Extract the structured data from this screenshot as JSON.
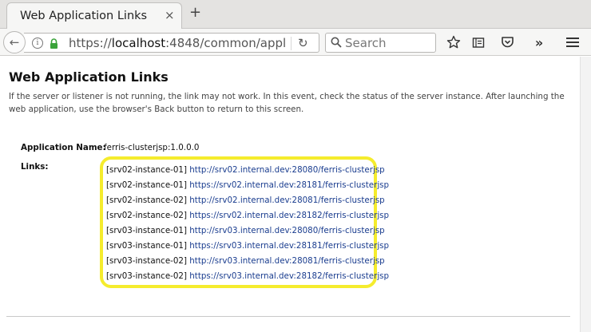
{
  "browser": {
    "tab_title": "Web Application Links",
    "close_symbol": "×",
    "new_tab_symbol": "+",
    "url_scheme": "https://",
    "url_host": "localhost",
    "url_rest": ":4848/common/appl",
    "search_placeholder": "Search",
    "icons": [
      "back-icon",
      "info-icon",
      "lock-icon",
      "reload-icon",
      "search-icon",
      "bookmark-star-icon",
      "reading-list-icon",
      "pocket-icon",
      "overflow-chevron-icon",
      "hamburger-menu-icon"
    ]
  },
  "page": {
    "title": "Web Application Links",
    "description": "If the server or listener is not running, the link may not work. In this event, check the status of the server instance. After launching the web application, use the browser's Back button to return to this screen.",
    "app_name_label": "Application Name:",
    "app_name_value": "ferris-clusterjsp:1.0.0.0",
    "links_label": "Links:",
    "links": [
      {
        "instance": "[srv02-instance-01]",
        "url": "http://srv02.internal.dev:28080/ferris-clusterjsp"
      },
      {
        "instance": "[srv02-instance-01]",
        "url": "https://srv02.internal.dev:28181/ferris-clusterjsp"
      },
      {
        "instance": "[srv02-instance-02]",
        "url": "http://srv02.internal.dev:28081/ferris-clusterjsp"
      },
      {
        "instance": "[srv02-instance-02]",
        "url": "https://srv02.internal.dev:28182/ferris-clusterjsp"
      },
      {
        "instance": "[srv03-instance-01]",
        "url": "http://srv03.internal.dev:28080/ferris-clusterjsp"
      },
      {
        "instance": "[srv03-instance-01]",
        "url": "https://srv03.internal.dev:28181/ferris-clusterjsp"
      },
      {
        "instance": "[srv03-instance-02]",
        "url": "http://srv03.internal.dev:28081/ferris-clusterjsp"
      },
      {
        "instance": "[srv03-instance-02]",
        "url": "https://srv03.internal.dev:28182/ferris-clusterjsp"
      }
    ]
  },
  "colors": {
    "highlight": "#f5ec2d",
    "link": "#1a3d8f",
    "lock": "#3aa33a"
  }
}
